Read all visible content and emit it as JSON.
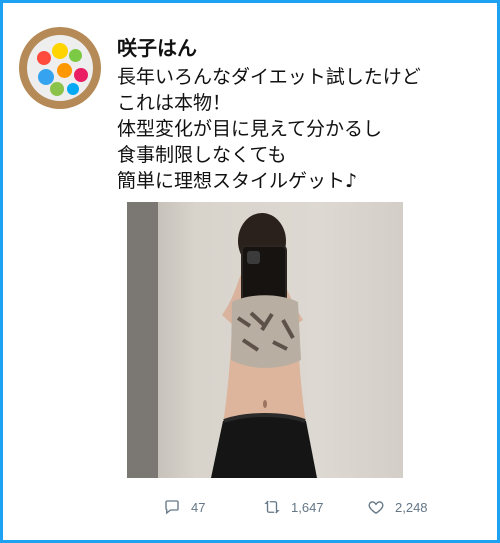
{
  "user": {
    "name": "咲子はん"
  },
  "tweet": {
    "text": "長年いろんなダイエット試したけど\nこれは本物！\n体型変化が目に見えて分かるし\n食事制限しなくても\n簡単に理想スタイルゲット♪"
  },
  "actions": {
    "reply_count": "47",
    "retweet_count": "1,647",
    "like_count": "2,248"
  },
  "colors": {
    "border": "#1da1f2",
    "icon": "#657786"
  },
  "icons": {
    "reply": "reply-icon",
    "retweet": "retweet-icon",
    "like": "heart-icon"
  }
}
